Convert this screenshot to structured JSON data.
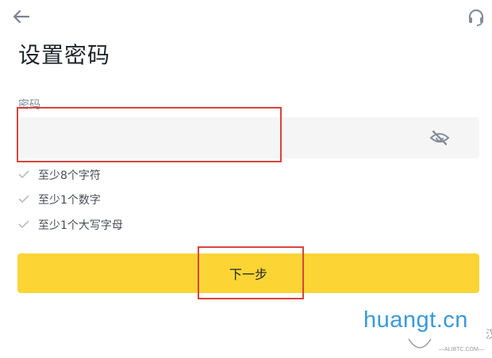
{
  "header": {
    "back_icon": "arrow-left-icon",
    "support_icon": "headset-icon",
    "title": "设置密码"
  },
  "form": {
    "password_label": "密码",
    "password_value": "",
    "password_placeholder": "",
    "visibility_icon": "eye-off-icon"
  },
  "requirements": [
    {
      "text": "至少8个字符",
      "icon": "check-icon"
    },
    {
      "text": "至少1个数字",
      "icon": "check-icon"
    },
    {
      "text": "至少1个大写字母",
      "icon": "check-icon"
    }
  ],
  "actions": {
    "next_label": "下一步"
  },
  "watermark": {
    "brand": "huangt.cn",
    "mark": "汉",
    "sub": "—ALIBTC.COM—"
  },
  "colors": {
    "accent": "#fcd535",
    "highlight": "#d9443b",
    "check": "#b7bdc6",
    "text": "#1e2329",
    "muted": "#848e9c",
    "watermark": "#3a9ad9"
  }
}
